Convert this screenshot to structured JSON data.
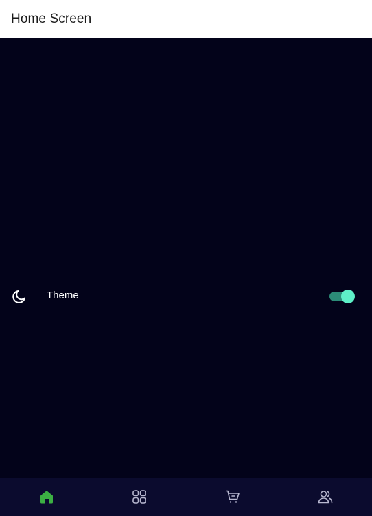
{
  "app_bar": {
    "title": "Home Screen"
  },
  "settings": {
    "theme_label": "Theme",
    "theme_icon": "moon-icon",
    "theme_toggle_on": true
  },
  "bottom_nav": {
    "items": [
      {
        "icon": "home-icon",
        "active": true
      },
      {
        "icon": "grid-icon",
        "active": false
      },
      {
        "icon": "cart-icon",
        "active": false
      },
      {
        "icon": "users-icon",
        "active": false
      }
    ]
  },
  "colors": {
    "background": "#03031a",
    "app_bar": "#ffffff",
    "nav_background": "#0b0b2e",
    "accent_active": "#3cb043",
    "nav_inactive": "#b8b8d0",
    "toggle_track": "#2c8c78",
    "toggle_thumb": "#5ef0c8"
  }
}
